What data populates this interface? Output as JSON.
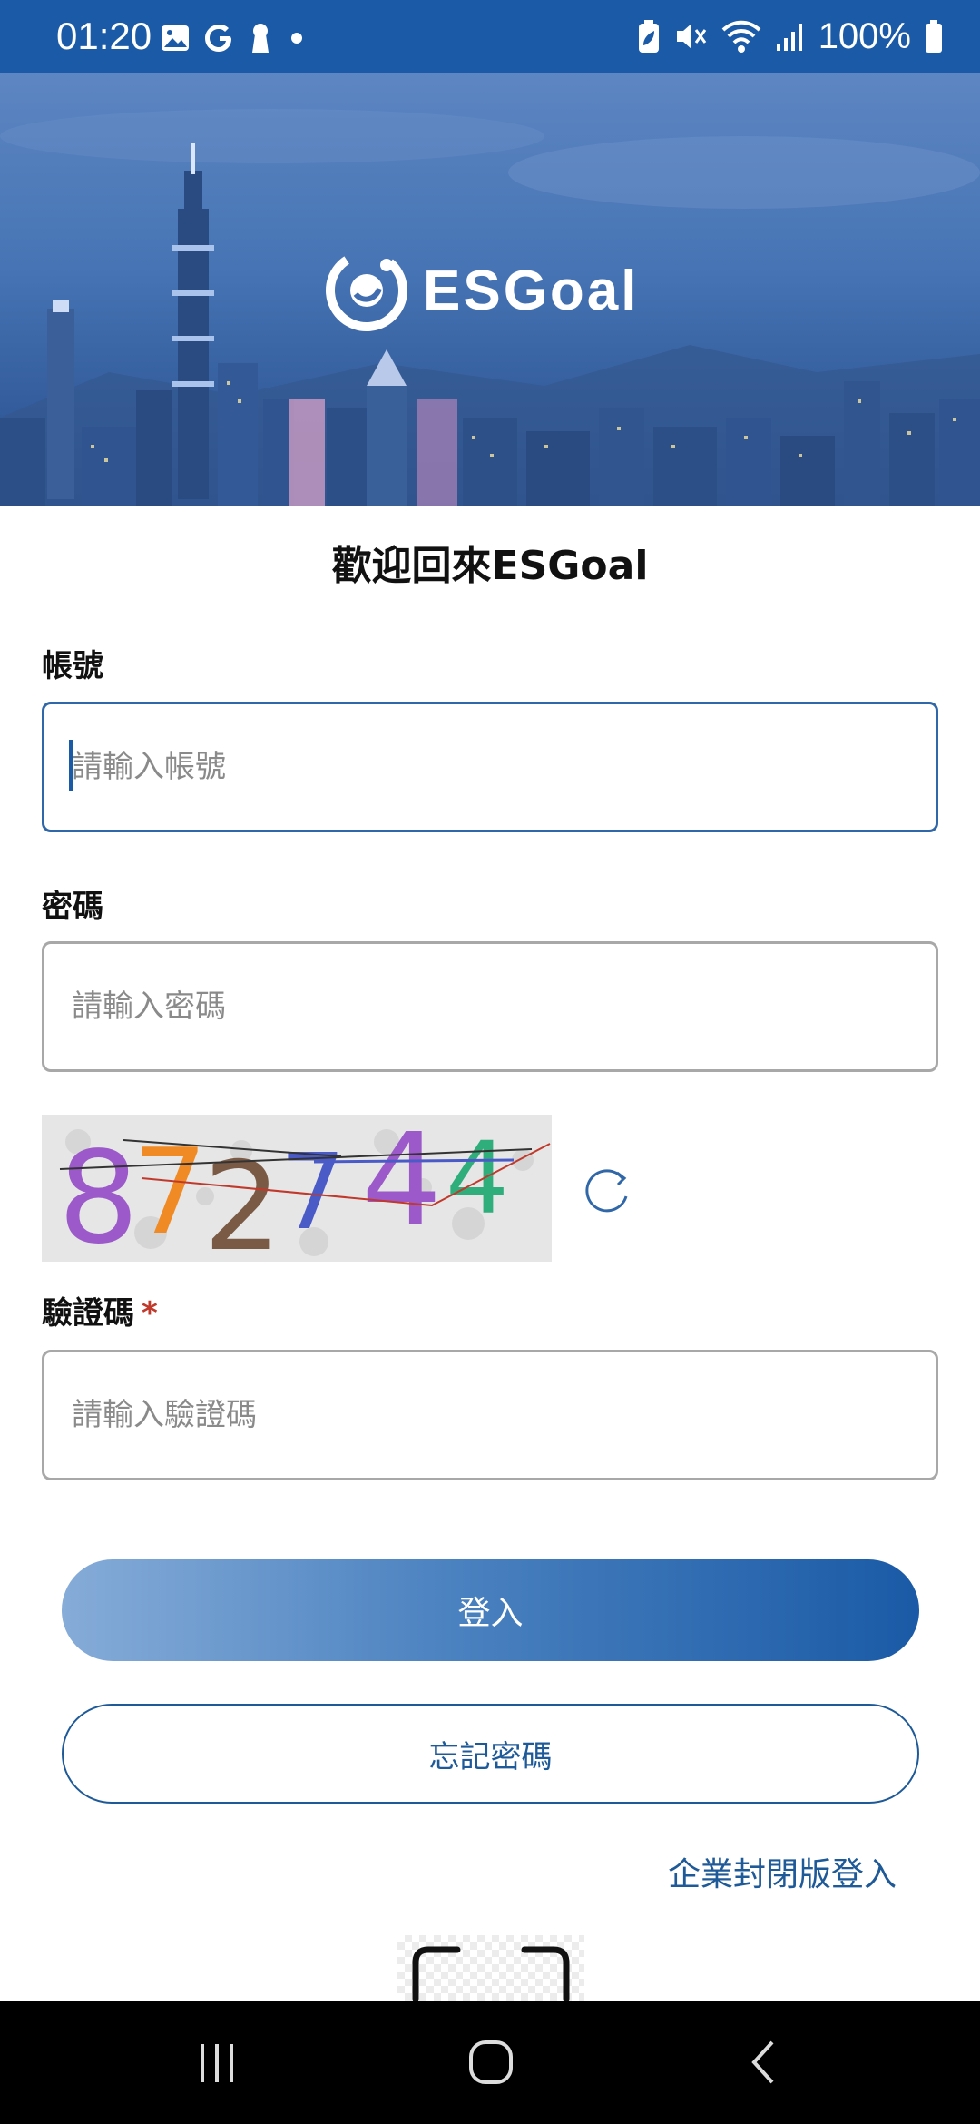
{
  "status_bar": {
    "time": "01:20",
    "battery": "100%",
    "notification_icons": [
      "gallery-icon",
      "google-icon",
      "keyhole-icon",
      "dot-icon"
    ],
    "system_icons": [
      "battery-saver-icon",
      "mute-icon",
      "wifi-icon",
      "signal-icon",
      "battery-icon"
    ]
  },
  "hero": {
    "brand_name": "ESGoal",
    "brand_ring_text": "ESGoal"
  },
  "welcome": {
    "title": "歡迎回來ESGoal"
  },
  "form": {
    "account": {
      "label": "帳號",
      "placeholder": "請輸入帳號",
      "value": ""
    },
    "password": {
      "label": "密碼",
      "placeholder": "請輸入密碼",
      "value": ""
    },
    "captcha": {
      "image_text": "872744",
      "label": "驗證碼",
      "required_mark": "*",
      "placeholder": "請輸入驗證碼",
      "value": ""
    }
  },
  "buttons": {
    "login": "登入",
    "forgot_password": "忘記密碼",
    "enterprise_login": "企業封閉版登入"
  },
  "nav_bar": {
    "icons": [
      "recent-apps-icon",
      "home-icon",
      "back-icon"
    ]
  },
  "colors": {
    "brand_blue": "#1a5aa6",
    "link_blue": "#1f5a98",
    "required_red": "#c0392b"
  }
}
